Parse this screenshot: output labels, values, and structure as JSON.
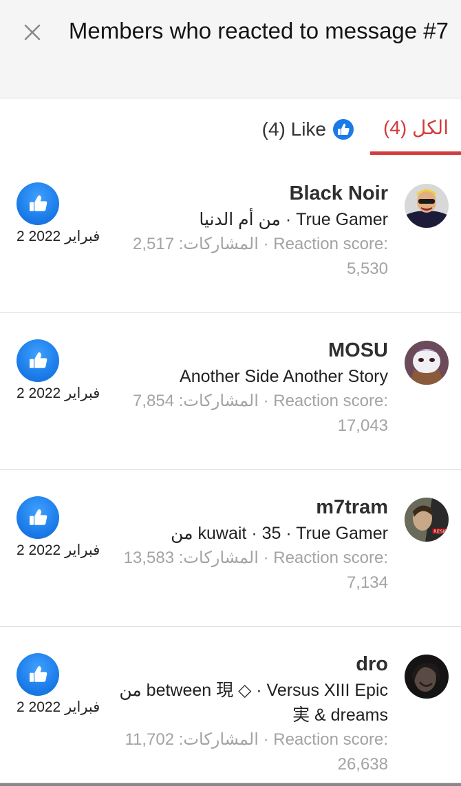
{
  "header": {
    "title": "Members who reacted to message #7"
  },
  "tabs": {
    "all_label": "الكل (4)",
    "like_label": "(4) Like"
  },
  "members": [
    {
      "username": "Black Noir",
      "title_line": "من أم الدنيا · True Gamer",
      "stats_line1": "المشاركات: 2,517 · Reaction score:",
      "stats_line2": "5,530",
      "date": "2 فبراير 2022"
    },
    {
      "username": "MOSU",
      "title_line": "Another Side Another Story",
      "stats_line1": "المشاركات: 7,854 · Reaction score:",
      "stats_line2": "17,043",
      "date": "2 فبراير 2022"
    },
    {
      "username": "m7tram",
      "title_line": "من kuwait · 35 · True Gamer",
      "stats_line1": "المشاركات: 13,583 · Reaction score:",
      "stats_line2": "7,134",
      "date": "2 فبراير 2022"
    },
    {
      "username": "dro",
      "title_line": "من between 現 ◇ · Versus XIII Epic",
      "title_line2": "実 & dreams",
      "stats_line1": "المشاركات: 11,702 · Reaction score: 26,638",
      "date": "2 فبراير 2022"
    }
  ],
  "colors": {
    "accent": "#d13c3c",
    "like_blue": "#1a7ae8",
    "muted_text": "#a3a3a3",
    "divider": "#dcdcdc"
  },
  "icons": {
    "close": "close-icon",
    "like": "thumbs-up-icon"
  }
}
